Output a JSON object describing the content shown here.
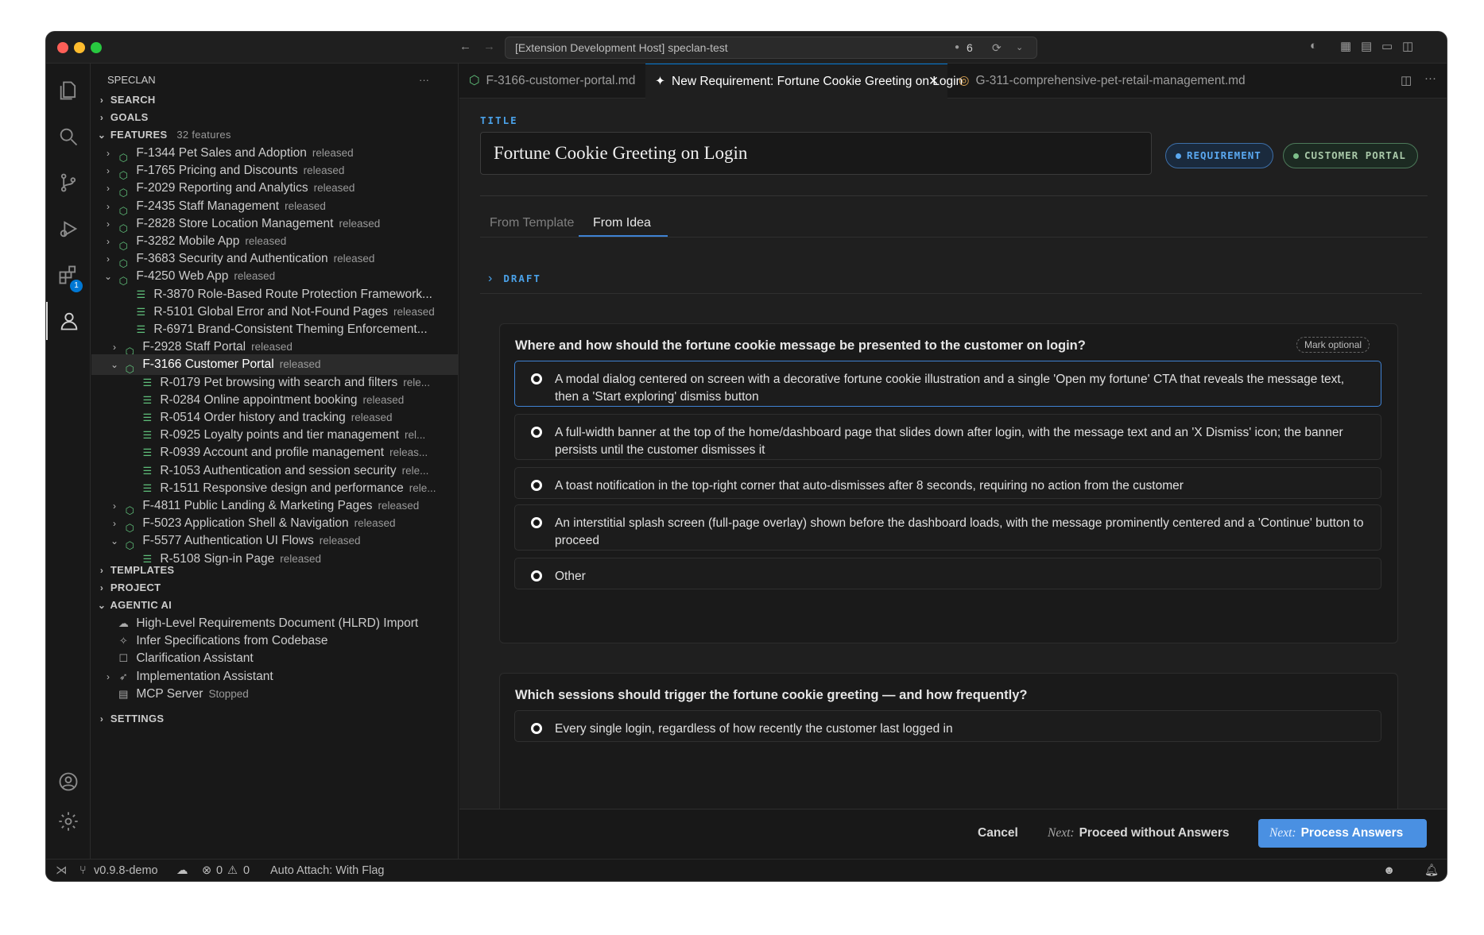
{
  "window": {
    "command_center": "[Extension Development Host] speclan-test",
    "notification_count": "6"
  },
  "activity": {
    "extensions_badge": "1"
  },
  "sidebar": {
    "title": "SPECLAN",
    "more": "···",
    "search": "SEARCH",
    "goals": "GOALS",
    "features": "FEATURES",
    "features_count": "32 features",
    "templates": "TEMPLATES",
    "project": "PROJECT",
    "agentic": "AGENTIC AI",
    "settings": "SETTINGS",
    "tree": [
      {
        "label": "F-1344 Pet Sales and Adoption",
        "status": "released",
        "kind": "feature",
        "depth": 0,
        "chev": ">"
      },
      {
        "label": "F-1765 Pricing and Discounts",
        "status": "released",
        "kind": "feature",
        "depth": 0,
        "chev": ">"
      },
      {
        "label": "F-2029 Reporting and Analytics",
        "status": "released",
        "kind": "feature",
        "depth": 0,
        "chev": ">"
      },
      {
        "label": "F-2435 Staff Management",
        "status": "released",
        "kind": "feature",
        "depth": 0,
        "chev": ">"
      },
      {
        "label": "F-2828 Store Location Management",
        "status": "released",
        "kind": "feature",
        "depth": 0,
        "chev": ">"
      },
      {
        "label": "F-3282 Mobile App",
        "status": "released",
        "kind": "feature",
        "depth": 0,
        "chev": ">"
      },
      {
        "label": "F-3683 Security and Authentication",
        "status": "released",
        "kind": "feature",
        "depth": 0,
        "chev": ">"
      },
      {
        "label": "F-4250 Web App",
        "status": "released",
        "kind": "feature",
        "depth": 0,
        "chev": "v"
      },
      {
        "label": "R-3870 Role-Based Route Protection Framework...",
        "status": "",
        "kind": "req",
        "depth": 1,
        "chev": ""
      },
      {
        "label": "R-5101 Global Error and Not-Found Pages",
        "status": "released",
        "kind": "req",
        "depth": 1,
        "chev": ""
      },
      {
        "label": "R-6971 Brand-Consistent Theming Enforcement...",
        "status": "",
        "kind": "req",
        "depth": 1,
        "chev": ""
      },
      {
        "label": "F-2928 Staff Portal",
        "status": "released",
        "kind": "feature",
        "depth": 1,
        "chev": ">"
      },
      {
        "label": "F-3166 Customer Portal",
        "status": "released",
        "kind": "feature",
        "depth": 1,
        "chev": "v",
        "selected": true
      },
      {
        "label": "R-0179 Pet browsing with search and filters",
        "status": "rele...",
        "kind": "req",
        "depth": 2,
        "chev": ""
      },
      {
        "label": "R-0284 Online appointment booking",
        "status": "released",
        "kind": "req",
        "depth": 2,
        "chev": ""
      },
      {
        "label": "R-0514 Order history and tracking",
        "status": "released",
        "kind": "req",
        "depth": 2,
        "chev": ""
      },
      {
        "label": "R-0925 Loyalty points and tier management",
        "status": "rel...",
        "kind": "req",
        "depth": 2,
        "chev": ""
      },
      {
        "label": "R-0939 Account and profile management",
        "status": "releas...",
        "kind": "req",
        "depth": 2,
        "chev": ""
      },
      {
        "label": "R-1053 Authentication and session security",
        "status": "rele...",
        "kind": "req",
        "depth": 2,
        "chev": ""
      },
      {
        "label": "R-1511 Responsive design and performance",
        "status": "rele...",
        "kind": "req",
        "depth": 2,
        "chev": ""
      },
      {
        "label": "F-4811 Public Landing & Marketing Pages",
        "status": "released",
        "kind": "feature",
        "depth": 1,
        "chev": ">"
      },
      {
        "label": "F-5023 Application Shell & Navigation",
        "status": "released",
        "kind": "feature",
        "depth": 1,
        "chev": ">"
      },
      {
        "label": "F-5577 Authentication UI Flows",
        "status": "released",
        "kind": "feature",
        "depth": 1,
        "chev": "v"
      },
      {
        "label": "R-5108 Sign-in Page",
        "status": "released",
        "kind": "req",
        "depth": 2,
        "chev": ""
      }
    ],
    "agentic_items": [
      {
        "label": "High-Level Requirements Document (HLRD) Import",
        "status": "",
        "icon": "cloud-gear-icon",
        "chev": ""
      },
      {
        "label": "Infer Specifications from Codebase",
        "status": "",
        "icon": "sparkle-icon",
        "chev": ""
      },
      {
        "label": "Clarification Assistant",
        "status": "",
        "icon": "chat-icon",
        "chev": ""
      },
      {
        "label": "Implementation Assistant",
        "status": "",
        "icon": "rocket-icon",
        "chev": ">"
      },
      {
        "label": "MCP Server",
        "status": "Stopped",
        "icon": "server-icon",
        "chev": ""
      }
    ]
  },
  "tabs": [
    {
      "label": "F-3166-customer-portal.md",
      "icon": "box-icon"
    },
    {
      "label": "New Requirement: Fortune Cookie Greeting on Login",
      "icon": "sparkle-icon",
      "active": true
    },
    {
      "label": "G-311-comprehensive-pet-retail-management.md",
      "icon": "target-icon"
    }
  ],
  "form": {
    "title_label": "TITLE",
    "title_value": "Fortune Cookie Greeting on Login",
    "badge_type": "REQUIREMENT",
    "badge_parent": "CUSTOMER PORTAL",
    "subtab_template": "From Template",
    "subtab_idea": "From Idea",
    "draft_label": "DRAFT",
    "q1": {
      "question": "Where and how should the fortune cookie message be presented to the customer on login?",
      "mark_optional": "Mark optional",
      "options": [
        "A modal dialog centered on screen with a decorative fortune cookie illustration and a single 'Open my fortune' CTA that reveals the message text, then a 'Start exploring' dismiss button",
        "A full-width banner at the top of the home/dashboard page that slides down after login, with the message text and an 'X Dismiss' icon; the banner persists until the customer dismisses it",
        "A toast notification in the top-right corner that auto-dismisses after 8 seconds, requiring no action from the customer",
        "An interstitial splash screen (full-page overlay) shown before the dashboard loads, with the message prominently centered and a 'Continue' button to proceed",
        "Other"
      ]
    },
    "q2": {
      "question": "Which sessions should trigger the fortune cookie greeting — and how frequently?",
      "options": [
        "Every single login, regardless of how recently the customer last logged in"
      ]
    }
  },
  "footer": {
    "cancel": "Cancel",
    "next_prefix": "Next:",
    "proceed": "Proceed without Answers",
    "process": "Process Answers"
  },
  "statusbar": {
    "branch": "v0.9.8-demo",
    "errors": "0",
    "warnings": "0",
    "auto_attach": "Auto Attach: With Flag"
  },
  "colors": {
    "accent": "#3f82d3",
    "feature_icon": "#5fbf7a",
    "label": "#4aa1e8",
    "primary_button": "#4a90e2"
  }
}
